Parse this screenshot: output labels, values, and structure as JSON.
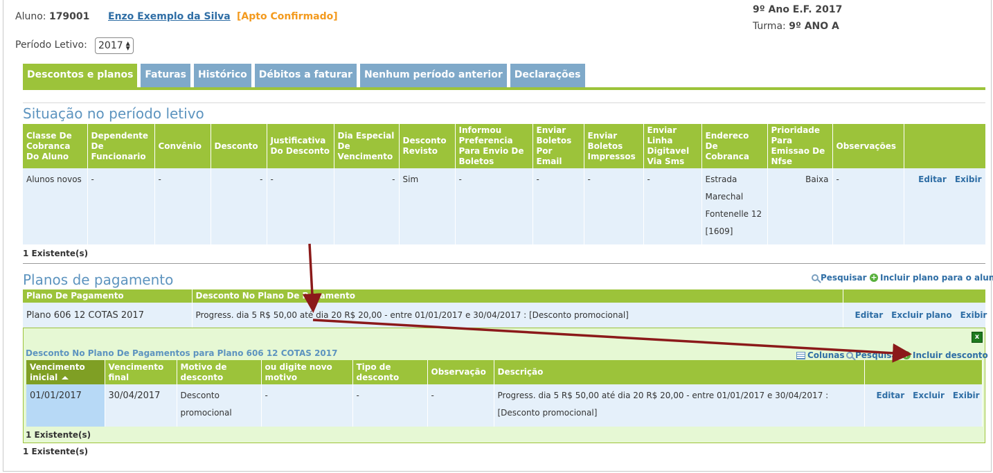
{
  "header": {
    "aluno_label": "Aluno:",
    "aluno_id": "179001",
    "aluno_name": "Enzo Exemplo da Silva",
    "status": "[Apto Confirmado]",
    "grade": "9º Ano E.F. 2017",
    "turma_label": "Turma:",
    "turma_value": "9º ANO A",
    "periodo_label": "Período Letivo:",
    "periodo_value": "2017"
  },
  "tabs": [
    {
      "label": "Descontos e planos",
      "active": true
    },
    {
      "label": "Faturas"
    },
    {
      "label": "Histórico"
    },
    {
      "label": "Débitos a faturar"
    },
    {
      "label": "Nenhum período anterior"
    },
    {
      "label": "Declarações"
    }
  ],
  "situacao": {
    "title": "Situação no período letivo",
    "columns": [
      "Classe De Cobranca Do Aluno",
      "Dependente De Funcionario",
      "Convênio",
      "Desconto",
      "Justificativa Do Desconto",
      "Dia Especial De Vencimento",
      "Desconto Revisto",
      "Informou Preferencia Para Envio De Boletos",
      "Enviar Boletos Por Email",
      "Enviar Boletos Impressos",
      "Enviar Linha Digitavel Via Sms",
      "Endereco De Cobranca",
      "Prioridade Para Emissao De Nfse",
      "Observações"
    ],
    "row": {
      "classe": "Alunos novos",
      "dependente": "-",
      "convenio": "-",
      "desconto": "-",
      "justificativa": "-",
      "dia_especial": "-",
      "revisto": "Sim",
      "informou": "-",
      "email": "-",
      "impressos": "-",
      "sms": "-",
      "endereco": "Estrada Marechal Fontenelle 12 [1609]",
      "prioridade": "Baixa",
      "observacoes": "-"
    },
    "actions": {
      "edit": "Editar",
      "view": "Exibir"
    },
    "count": "1 Existente(s)"
  },
  "planos": {
    "title": "Planos de pagamento",
    "search": "Pesquisar",
    "add": "Incluir plano para o aluno",
    "columns": [
      "Plano De Pagamento",
      "Desconto No Plano De Pagamento"
    ],
    "row": {
      "plano": "Plano 606 12 COTAS 2017",
      "desconto": "Progress. dia 5 R$ 50,00 até dia 20 R$ 20,00 - entre 01/01/2017 e 30/04/2017 : [Desconto promocional]"
    },
    "actions": {
      "edit": "Editar",
      "delete": "Excluir plano",
      "view": "Exibir"
    },
    "count": "1 Existente(s)"
  },
  "subpanel": {
    "close": "x",
    "title": "Desconto No Plano De Pagamentos para Plano 606 12 COTAS 2017",
    "columns_link": "Colunas",
    "search": "Pesquisar",
    "add": "Incluir desconto",
    "columns": [
      "Vencimento inicial",
      "Vencimento final",
      "Motivo de desconto",
      "ou digite novo motivo",
      "Tipo de desconto",
      "Observação",
      "Descrição"
    ],
    "row": {
      "venc_inicial": "01/01/2017",
      "venc_final": "30/04/2017",
      "motivo": "Desconto promocional",
      "novo_motivo": "-",
      "tipo": "-",
      "observacao": "-",
      "descricao": "Progress. dia 5 R$ 50,00 até dia 20 R$ 20,00 - entre 01/01/2017 e 30/04/2017 : [Desconto promocional]"
    },
    "actions": {
      "edit": "Editar",
      "delete": "Excluir",
      "view": "Exibir"
    },
    "count": "1 Existente(s)"
  },
  "colors": {
    "green": "#9cc33a",
    "blue_tab": "#7fa9c9",
    "title_blue": "#5d94bf",
    "arrow": "#8b1a1a"
  }
}
